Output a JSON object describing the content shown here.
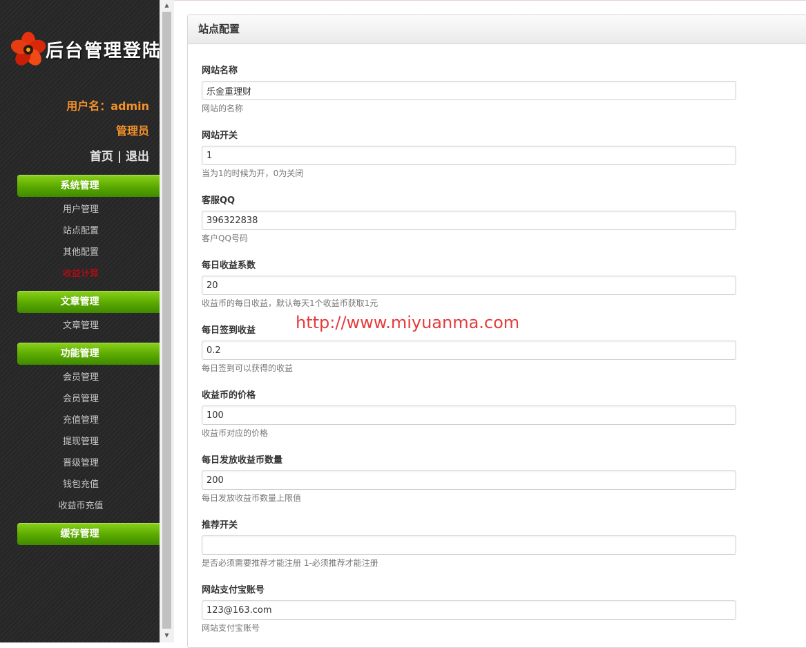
{
  "sidebar": {
    "logo_text": "后台管理登陆",
    "username_line": "用户名：admin",
    "role": "管理员",
    "home_link": "首页",
    "separator": "|",
    "logout_link": "退出",
    "sections": [
      {
        "title": "系统管理",
        "items": [
          {
            "label": "用户管理"
          },
          {
            "label": "站点配置"
          },
          {
            "label": "其他配置"
          },
          {
            "label": "收益计算",
            "active": true
          }
        ]
      },
      {
        "title": "文章管理",
        "items": [
          {
            "label": "文章管理"
          }
        ]
      },
      {
        "title": "功能管理",
        "items": [
          {
            "label": "会员管理"
          },
          {
            "label": "会员管理"
          },
          {
            "label": "充值管理"
          },
          {
            "label": "提现管理"
          },
          {
            "label": "晋级管理"
          },
          {
            "label": "钱包充值"
          },
          {
            "label": "收益币充值"
          }
        ]
      },
      {
        "title": "缓存管理",
        "items": []
      }
    ]
  },
  "panel": {
    "title": "站点配置",
    "fields": [
      {
        "label": "网站名称",
        "value": "乐金重理财",
        "help": "网站的名称"
      },
      {
        "label": "网站开关",
        "value": "1",
        "help": "当为1的时候为开，0为关闭"
      },
      {
        "label": "客服QQ",
        "value": "396322838",
        "help": "客户QQ号码"
      },
      {
        "label": "每日收益系数",
        "value": "20",
        "help": "收益币的每日收益，默认每天1个收益币获取1元"
      },
      {
        "label": "每日签到收益",
        "value": "0.2",
        "help": "每日签到可以获得的收益"
      },
      {
        "label": "收益币的价格",
        "value": "100",
        "help": "收益币对应的价格"
      },
      {
        "label": "每日发放收益币数量",
        "value": "200",
        "help": "每日发放收益币数量上限值"
      },
      {
        "label": "推荐开关",
        "value": "",
        "help": "是否必须需要推荐才能注册 1-必须推荐才能注册"
      },
      {
        "label": "网站支付宝账号",
        "value": "123@163.com",
        "help": "网站支付宝账号"
      }
    ]
  },
  "watermark": "http://www.miyuanma.com",
  "colors": {
    "sidebar_bg": "#262626",
    "section_green": "#5aa900",
    "user_orange": "#f4922a",
    "active_red": "#e3000f",
    "watermark_red": "#e53b3b"
  }
}
